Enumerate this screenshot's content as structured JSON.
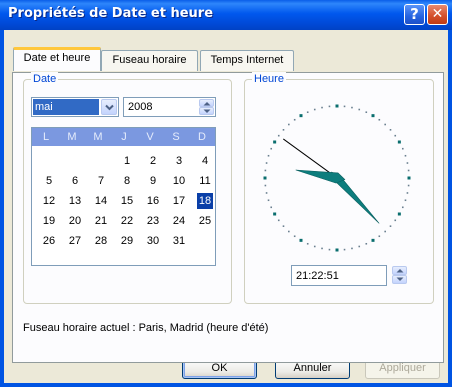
{
  "window": {
    "title": "Propriétés de Date et heure",
    "help_glyph": "?",
    "close_glyph": "✕"
  },
  "tabs": [
    {
      "label": "Date et heure",
      "active": true
    },
    {
      "label": "Fuseau horaire",
      "active": false
    },
    {
      "label": "Temps Internet",
      "active": false
    }
  ],
  "date_group": {
    "label": "Date",
    "month": "mai",
    "year": "2008",
    "calendar": {
      "weekday_headers": [
        "L",
        "M",
        "M",
        "J",
        "V",
        "S",
        "D"
      ],
      "weeks": [
        [
          "",
          "",
          "",
          "1",
          "2",
          "3",
          "4"
        ],
        [
          "5",
          "6",
          "7",
          "8",
          "9",
          "10",
          "11"
        ],
        [
          "12",
          "13",
          "14",
          "15",
          "16",
          "17",
          "18"
        ],
        [
          "19",
          "20",
          "21",
          "22",
          "23",
          "24",
          "25"
        ],
        [
          "26",
          "27",
          "28",
          "29",
          "30",
          "31",
          ""
        ]
      ],
      "selected_day": "18"
    }
  },
  "time_group": {
    "label": "Heure",
    "time": "21:22:51",
    "clock": {
      "hours": 21,
      "minutes": 22,
      "seconds": 51
    }
  },
  "timezone_text": "Fuseau horaire actuel : Paris, Madrid (heure d'été)",
  "buttons": {
    "ok": "OK",
    "cancel": "Annuler",
    "apply": "Appliquer"
  },
  "colors": {
    "title_bar": "#0054e3",
    "accent_selection": "#316ac5",
    "clock_hands": "#008080",
    "group_label": "#0046d5"
  }
}
